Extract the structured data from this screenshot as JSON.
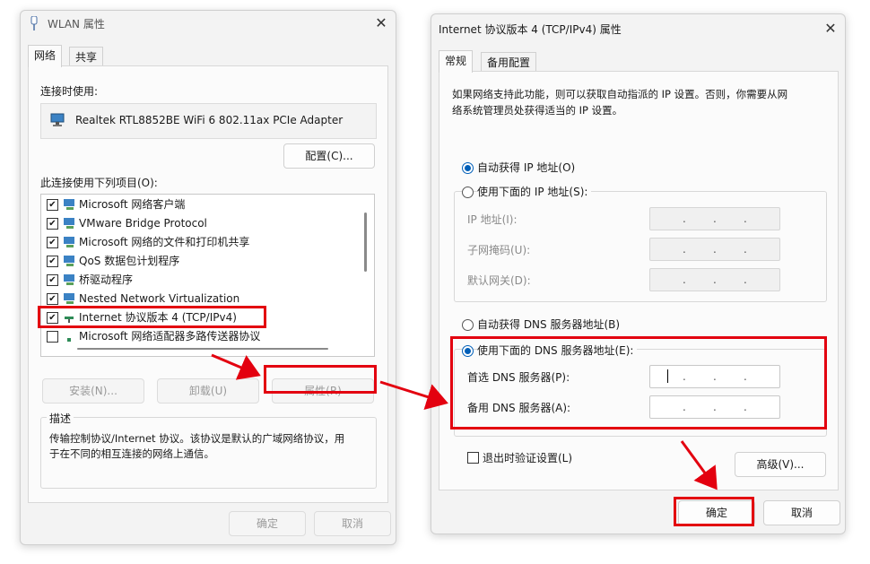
{
  "left_window": {
    "title": "WLAN 属性",
    "close_glyph": "✕",
    "tabs": [
      "网络",
      "共享"
    ],
    "connect_using_label": "连接时使用:",
    "adapter_name": "Realtek RTL8852BE WiFi 6 802.11ax PCIe Adapter",
    "configure_button": "配置(C)...",
    "items_label": "此连接使用下列项目(O):",
    "items": [
      {
        "label": "Microsoft 网络客户端",
        "checked": true
      },
      {
        "label": "VMware Bridge Protocol",
        "checked": true
      },
      {
        "label": "Microsoft 网络的文件和打印机共享",
        "checked": true
      },
      {
        "label": "QoS 数据包计划程序",
        "checked": true
      },
      {
        "label": "桥驱动程序",
        "checked": true
      },
      {
        "label": "Nested Network Virtualization",
        "checked": true
      },
      {
        "label": "Internet 协议版本 4 (TCP/IPv4)",
        "checked": true
      },
      {
        "label": "Microsoft 网络适配器多路传送器协议",
        "checked": false
      }
    ],
    "install_button": "安装(N)...",
    "uninstall_button": "卸载(U)",
    "properties_button": "属性(R)",
    "description_title": "描述",
    "description_text_line1": "传输控制协议/Internet 协议。该协议是默认的广域网络协议，用",
    "description_text_line2": "于在不同的相互连接的网络上通信。",
    "ok_button": "确定",
    "cancel_button": "取消"
  },
  "right_window": {
    "title": "Internet 协议版本 4 (TCP/IPv4) 属性",
    "close_glyph": "✕",
    "tabs": [
      "常规",
      "备用配置"
    ],
    "intro_line1": "如果网络支持此功能，则可以获取自动指派的 IP 设置。否则，你需要从网",
    "intro_line2": "络系统管理员处获得适当的 IP 设置。",
    "auto_ip_label": "自动获得 IP 地址(O)",
    "manual_ip_label": "使用下面的 IP 地址(S):",
    "ip_address_label": "IP 地址(I):",
    "subnet_label": "子网掩码(U):",
    "gateway_label": "默认网关(D):",
    "auto_dns_label": "自动获得 DNS 服务器地址(B)",
    "manual_dns_label": "使用下面的 DNS 服务器地址(E):",
    "preferred_dns_label": "首选 DNS 服务器(P):",
    "alternate_dns_label": "备用 DNS 服务器(A):",
    "ip_dot": ".",
    "validate_label": "退出时验证设置(L)",
    "advanced_button": "高级(V)...",
    "ok_button": "确定",
    "cancel_button": "取消"
  },
  "colors": {
    "highlight_red": "#e3000f",
    "accent_blue": "#005fb8"
  }
}
